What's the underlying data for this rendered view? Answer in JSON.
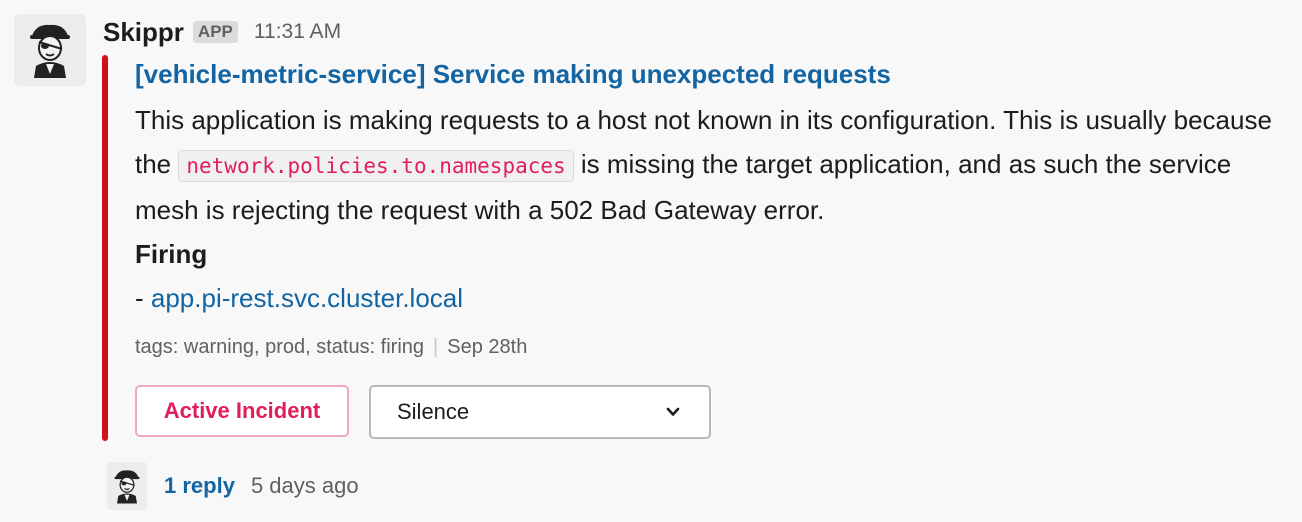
{
  "message": {
    "bot_name": "Skippr",
    "app_badge": "APP",
    "timestamp": "11:31 AM",
    "avatar_icon": "pirate-icon"
  },
  "attachment": {
    "color": "#d00f1c",
    "title": "[vehicle-metric-service] Service making unexpected requests",
    "body_part1": "This application is making requests to a host not known in its configuration. This is usually because the ",
    "code": "network.policies.to.namespaces",
    "body_part2": " is missing the target application, and as such the service mesh is rejecting the request with a 502 Bad Gateway error.",
    "firing_label": "Firing",
    "firing_prefix": "- ",
    "firing_host": "app.pi-rest.svc.cluster.local",
    "footer_tags": "tags: warning, prod, status: firing",
    "footer_date": "Sep 28th"
  },
  "actions": {
    "incident_button": "Active Incident",
    "silence_select": "Silence",
    "silence_icon": "chevron-down-icon"
  },
  "thread": {
    "reply_count": "1 reply",
    "reply_time": "5 days ago"
  }
}
